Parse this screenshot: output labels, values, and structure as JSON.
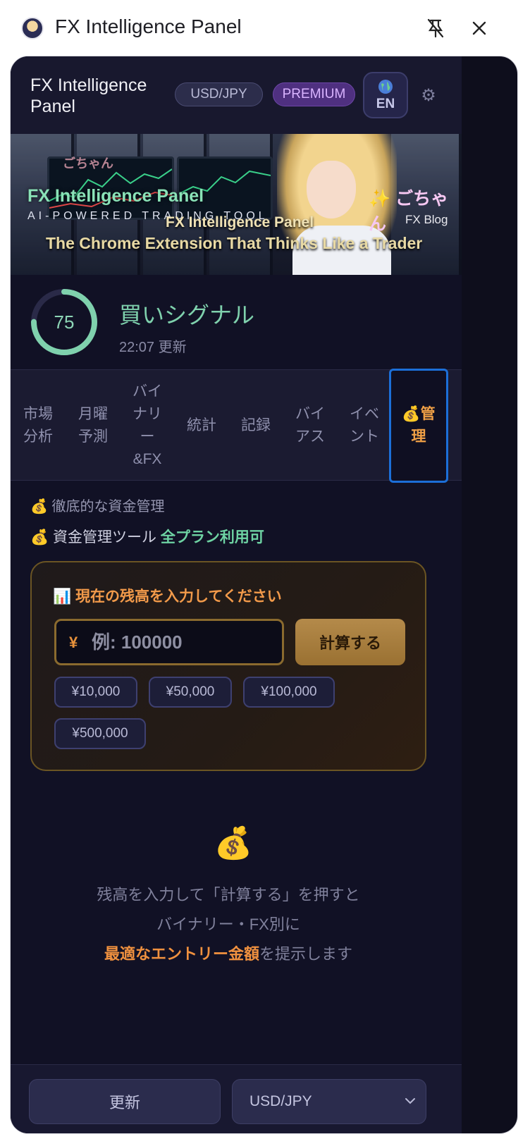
{
  "window": {
    "title": "FX Intelligence Panel"
  },
  "header": {
    "title": "FX Intelligence Panel",
    "pair_badge": "USD/JPY",
    "plan_badge": "PREMIUM",
    "lang_label": "EN"
  },
  "banner": {
    "title": "FX Intelligence Panel",
    "subtitle": "AI-POWERED TRADING TOOL",
    "caption_line1": "FX Intelligence Panel",
    "caption_line2": "The Chrome Extension That Thinks Like a Trader",
    "brand_name": "✨ ごちゃん",
    "brand_sub": "FX Blog",
    "watermark": "ごちゃん"
  },
  "signal": {
    "score": "75",
    "score_fraction": 0.75,
    "label": "買いシグナル",
    "updated": "22:07 更新"
  },
  "tabs": [
    {
      "label": "市場\n分析"
    },
    {
      "label": "月曜\n予測"
    },
    {
      "label": "バイ\nナリ\nー\n&FX"
    },
    {
      "label": "統計"
    },
    {
      "label": "記録"
    },
    {
      "label": "バイ\nアス"
    },
    {
      "label": "イベ\nント"
    },
    {
      "label": "💰管\n理"
    }
  ],
  "management": {
    "section_title": "💰 徹底的な資金管理",
    "tool_label": "💰 資金管理ツール",
    "tool_availability": "全プラン利用可",
    "card_heading": "📊 現在の残高を入力してください",
    "currency_symbol": "¥",
    "balance_placeholder": "例: 100000",
    "balance_value": "",
    "calculate_label": "計算する",
    "presets": [
      "¥10,000",
      "¥50,000",
      "¥100,000",
      "¥500,000"
    ]
  },
  "empty_state": {
    "icon": "💰",
    "line1": "残高を入力して「計算する」を押すと",
    "line2": "バイナリー・FX別に",
    "line3_highlight": "最適なエントリー金額",
    "line3_rest": "を提示します"
  },
  "footer": {
    "refresh_label": "更新",
    "pair_selected": "USD/JPY"
  },
  "colors": {
    "accent_green": "#7fd1ad",
    "accent_orange": "#f0913f",
    "active_tab_border": "#1c6fd8",
    "panel_bg": "#111125"
  }
}
